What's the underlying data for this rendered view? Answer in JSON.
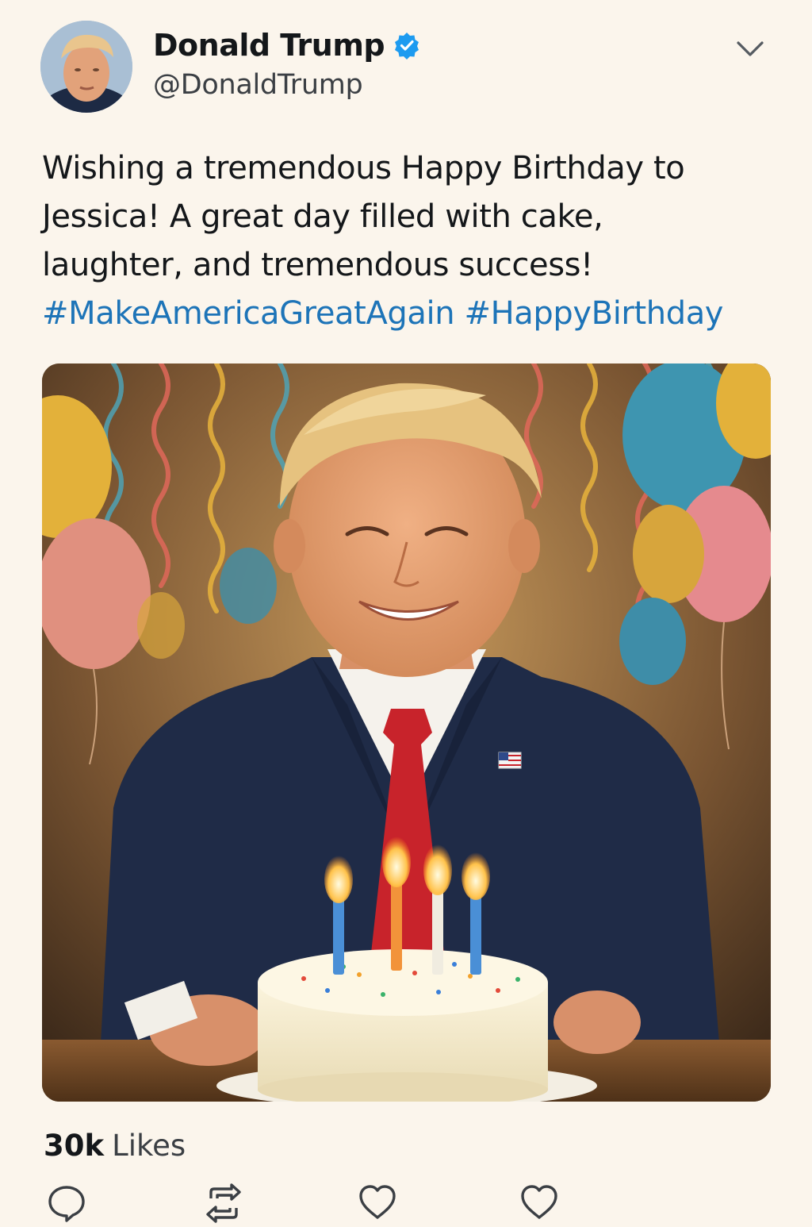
{
  "tweet": {
    "author": {
      "display_name": "Donald Trump",
      "handle": "@DonaldTrump",
      "verified": true,
      "verified_icon": "verified-badge-icon"
    },
    "text_lines": [
      "Wishing a tremendous Happy Birthday to",
      "Jessica! A great day filled with cake,",
      "laughter, and tremendous success!"
    ],
    "hashtags": [
      "#MakeAmericaGreatAgain",
      "#HappyBirthday"
    ],
    "media": {
      "kind": "photo",
      "subject": "man in navy suit and red tie smiling behind a birthday cake with four lit candles, balloons and streamers in background"
    },
    "stats": {
      "likes_count": "30k",
      "likes_label": "Likes"
    },
    "actions": [
      {
        "name": "reply",
        "icon": "reply-icon"
      },
      {
        "name": "retweet",
        "icon": "retweet-icon"
      },
      {
        "name": "like",
        "icon": "heart-icon"
      },
      {
        "name": "like-secondary",
        "icon": "heart-icon"
      }
    ]
  },
  "colors": {
    "background": "#fbf5ec",
    "text": "#14171a",
    "secondary_text": "#3b3f44",
    "link": "#1d74b8",
    "verified": "#1d9bf0"
  }
}
